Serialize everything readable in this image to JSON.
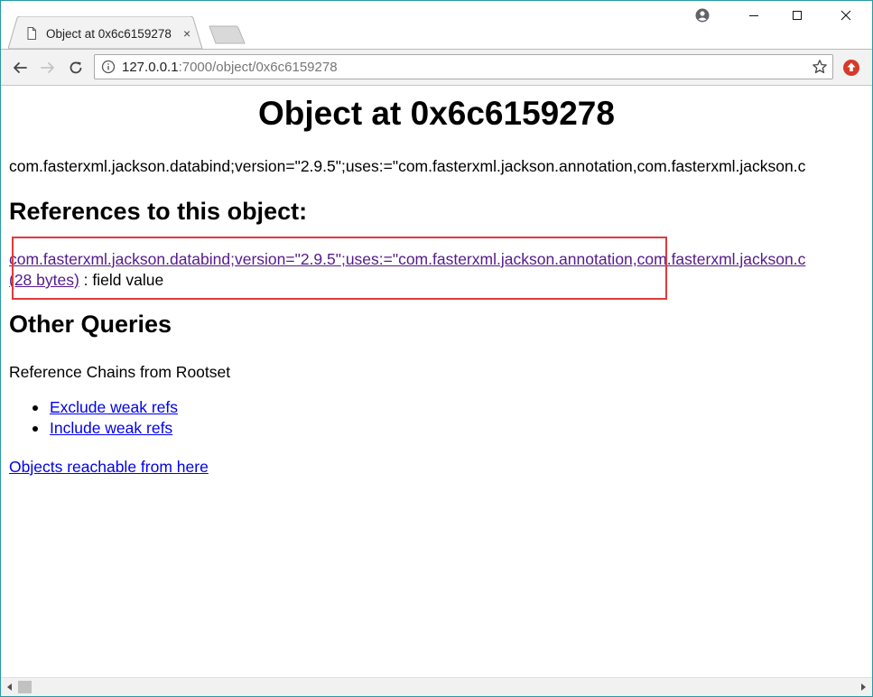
{
  "browser": {
    "tab_title": "Object at 0x6c6159278",
    "tab_close_glyph": "×",
    "url_host": "127.0.0.1",
    "url_path": ":7000/object/0x6c6159278",
    "accent_color": "#2a9aa6"
  },
  "page": {
    "title": "Object at 0x6c6159278",
    "object_description": "com.fasterxml.jackson.databind;version=\"2.9.5\";uses:=\"com.fasterxml.jackson.annotation,com.fasterxml.jackson.c",
    "references_heading": "References to this object:",
    "reference_link_line1": "com.fasterxml.jackson.databind;version=\"2.9.5\";uses:=\"com.fasterxml.jackson.annotation,com.fasterxml.jackson.c",
    "reference_link_line2": "(28 bytes)",
    "reference_suffix": " : field value",
    "other_queries_heading": "Other Queries",
    "chains_label": "Reference Chains from Rootset",
    "chain_links": [
      "Exclude weak refs",
      "Include weak refs"
    ],
    "reachable_link": "Objects reachable from here",
    "highlight_color": "#e03a3a",
    "link_color": "#0000ee",
    "visited_link_color": "#551a8b"
  }
}
